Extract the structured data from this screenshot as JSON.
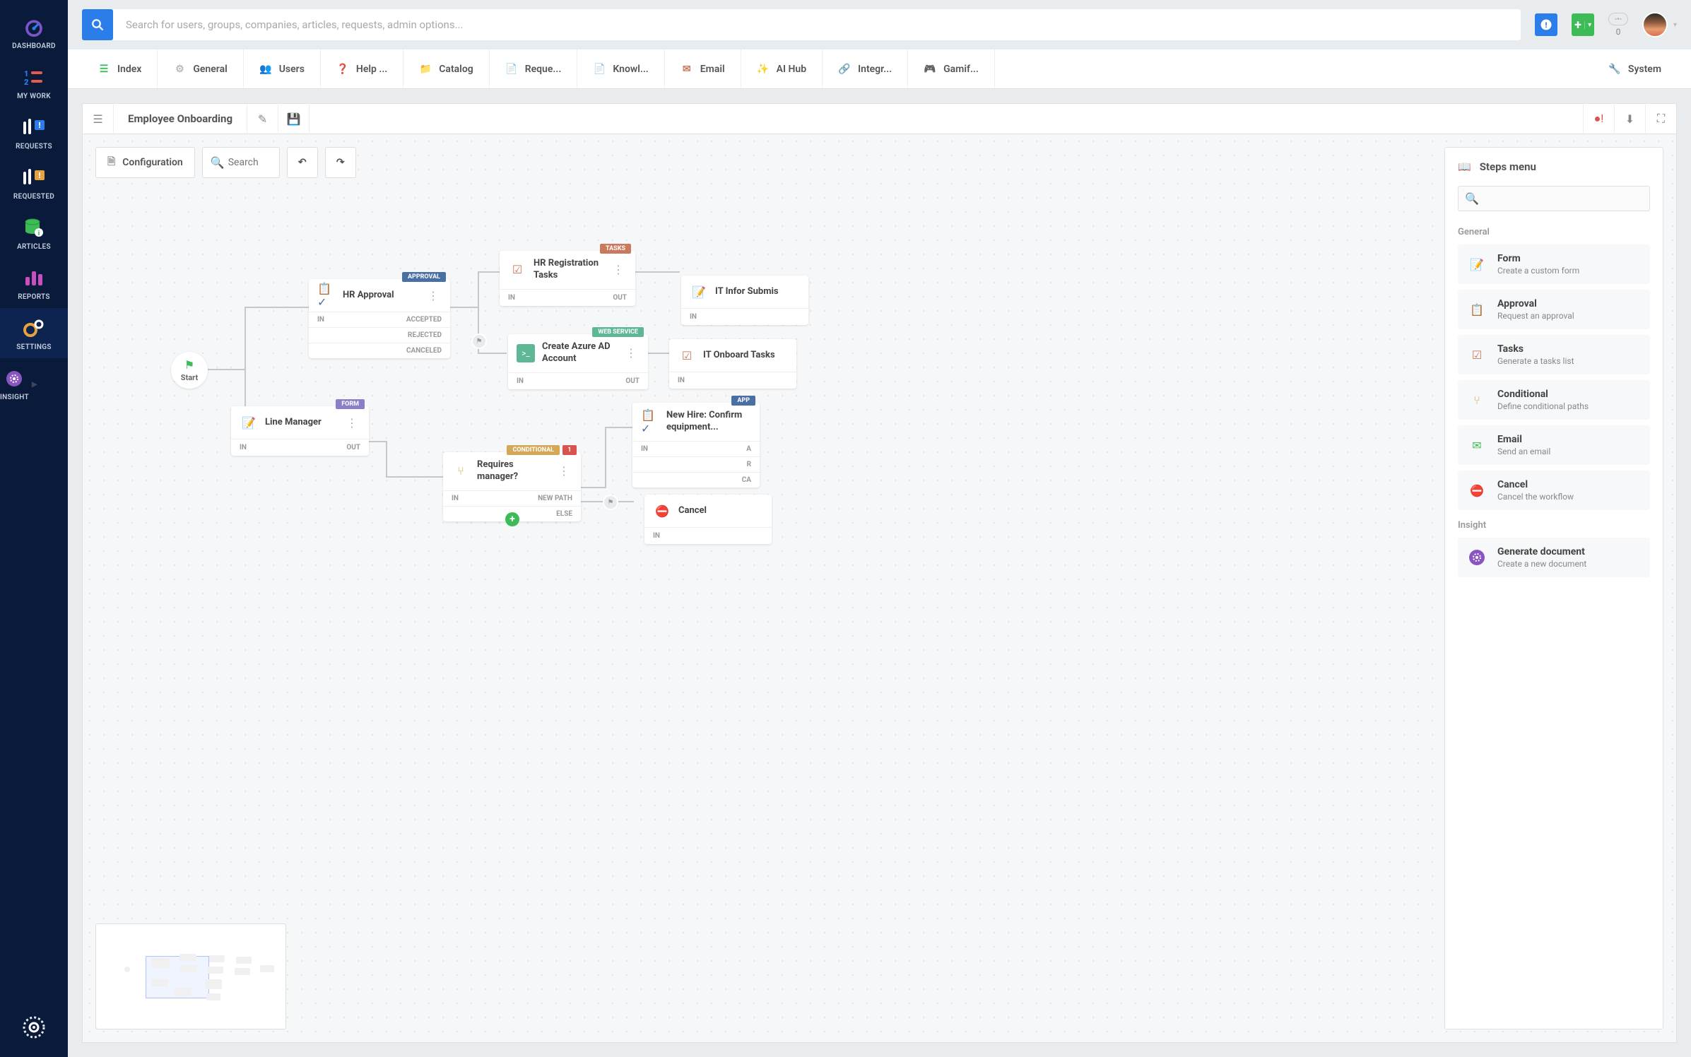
{
  "sidebar": {
    "items": [
      {
        "label": "DASHBOARD",
        "icon": "gauge",
        "color": "#7b55c7"
      },
      {
        "label": "MY WORK",
        "icon": "list-numbered",
        "color": "#e85a4f"
      },
      {
        "label": "REQUESTS",
        "icon": "request",
        "color": "#2b7de9"
      },
      {
        "label": "REQUESTED",
        "icon": "requested",
        "color": "#e8a23d"
      },
      {
        "label": "ARTICLES",
        "icon": "database",
        "color": "#3dbb56"
      },
      {
        "label": "REPORTS",
        "icon": "bar-chart",
        "color": "#c94fc1"
      },
      {
        "label": "SETTINGS",
        "icon": "gears",
        "color": "#e8a23d"
      },
      {
        "label": "INSIGHT",
        "icon": "insight",
        "color": "#8a55c1"
      }
    ],
    "active_index": 6
  },
  "search": {
    "placeholder": "Search for users, groups, companies, articles, requests, admin options..."
  },
  "topbar": {
    "counter": "0"
  },
  "tabs": [
    {
      "label": "Index",
      "icon": "list",
      "color": "#3dbb56"
    },
    {
      "label": "General",
      "icon": "gear",
      "color": "#bbb"
    },
    {
      "label": "Users",
      "icon": "users",
      "color": "#e8c13d"
    },
    {
      "label": "Help ...",
      "icon": "help",
      "color": "#bbb"
    },
    {
      "label": "Catalog",
      "icon": "folder",
      "color": "#e8a23d"
    },
    {
      "label": "Reque...",
      "icon": "file",
      "color": "#2b7de9"
    },
    {
      "label": "Knowl...",
      "icon": "doc",
      "color": "#3dbb56"
    },
    {
      "label": "Email",
      "icon": "mail",
      "color": "#c97a5e"
    },
    {
      "label": "AI Hub",
      "icon": "wand",
      "color": "#c94fc1"
    },
    {
      "label": "Integr...",
      "icon": "link",
      "color": "#4a6fa5"
    },
    {
      "label": "Gamif...",
      "icon": "game",
      "color": "#e85a4f"
    },
    {
      "label": "System",
      "icon": "wrench",
      "color": "#bbb"
    }
  ],
  "editor": {
    "title": "Employee Onboarding",
    "config_btn": "Configuration",
    "search_placeholder": "Search"
  },
  "start_node": {
    "label": "Start"
  },
  "nodes": {
    "hr_approval": {
      "title": "HR Approval",
      "badge": "APPROVAL",
      "ports": [
        "IN",
        "ACCEPTED",
        "REJECTED",
        "CANCELED"
      ]
    },
    "line_manager": {
      "title": "Line Manager",
      "badge": "FORM",
      "in": "IN",
      "out": "OUT"
    },
    "hr_tasks": {
      "title": "HR Registration Tasks",
      "badge": "TASKS",
      "in": "IN",
      "out": "OUT"
    },
    "azure": {
      "title": "Create Azure AD Account",
      "badge": "WEB SERVICE",
      "in": "IN",
      "out": "OUT"
    },
    "requires_mgr": {
      "title": "Requires manager?",
      "badge": "CONDITIONAL",
      "err": "1",
      "in": "IN",
      "p1": "NEW PATH",
      "p2": "ELSE"
    },
    "it_info": {
      "title": "IT Infor Submis",
      "in": "IN"
    },
    "it_onboard": {
      "title": "IT Onboard Tasks",
      "in": "IN"
    },
    "new_hire": {
      "title": "New Hire: Confirm equipment...",
      "badge": "APP",
      "in": "IN",
      "p1": "A",
      "p2": "R",
      "p3": "CA"
    },
    "cancel": {
      "title": "Cancel",
      "in": "IN"
    }
  },
  "steps_panel": {
    "title": "Steps menu",
    "search_placeholder": "",
    "sections": [
      {
        "title": "General",
        "items": [
          {
            "title": "Form",
            "desc": "Create a custom form",
            "icon": "form",
            "color": "#c97a5e"
          },
          {
            "title": "Approval",
            "desc": "Request an approval",
            "icon": "approval",
            "color": "#4a6fa5"
          },
          {
            "title": "Tasks",
            "desc": "Generate a tasks list",
            "icon": "tasks",
            "color": "#c97a5e"
          },
          {
            "title": "Conditional",
            "desc": "Define conditional paths",
            "icon": "cond",
            "color": "#d4a857"
          },
          {
            "title": "Email",
            "desc": "Send an email",
            "icon": "mail",
            "color": "#3dbb56"
          },
          {
            "title": "Cancel",
            "desc": "Cancel the workflow",
            "icon": "cancel",
            "color": "#d9534f"
          }
        ]
      },
      {
        "title": "Insight",
        "items": [
          {
            "title": "Generate document",
            "desc": "Create a new document",
            "icon": "insight",
            "color": "#8a55c1"
          }
        ]
      }
    ]
  }
}
